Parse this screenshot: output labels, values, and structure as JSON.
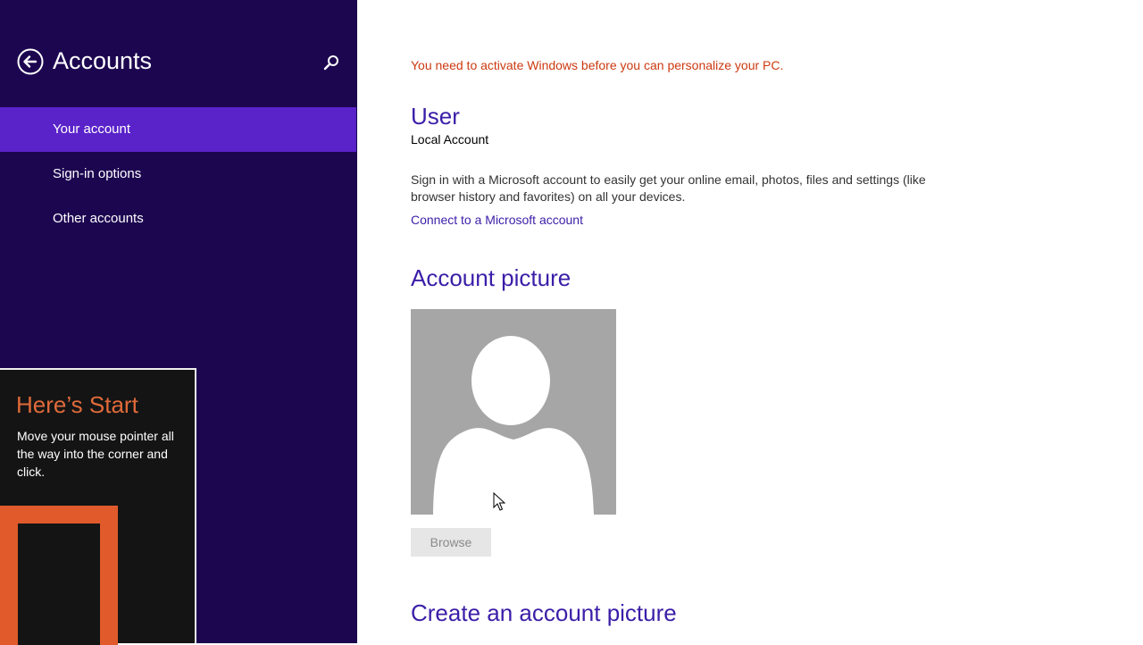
{
  "sidebar": {
    "title": "Accounts",
    "back_icon": "back-arrow-icon",
    "search_icon": "search-icon",
    "items": [
      {
        "label": "Your account",
        "selected": true
      },
      {
        "label": "Sign-in options",
        "selected": false
      },
      {
        "label": "Other accounts",
        "selected": false
      }
    ]
  },
  "start_tip": {
    "title": "Here’s Start",
    "body": "Move your mouse pointer all the way into the corner and click."
  },
  "main": {
    "activation_warning": "You need to activate Windows before you can personalize your PC.",
    "user_heading": "User",
    "account_type": "Local Account",
    "description": "Sign in with a Microsoft account to easily get your online email, photos, files and settings (like browser history and favorites) on all your devices.",
    "connect_link": "Connect to a Microsoft account",
    "picture_heading": "Account picture",
    "browse_label": "Browse",
    "create_heading": "Create an account picture"
  },
  "colors": {
    "sidebar_bg": "#1c0650",
    "selected_bg": "#5a22c9",
    "accent": "#3b1ea8",
    "warning": "#cc3a10",
    "start_orange": "#e05a2b"
  }
}
